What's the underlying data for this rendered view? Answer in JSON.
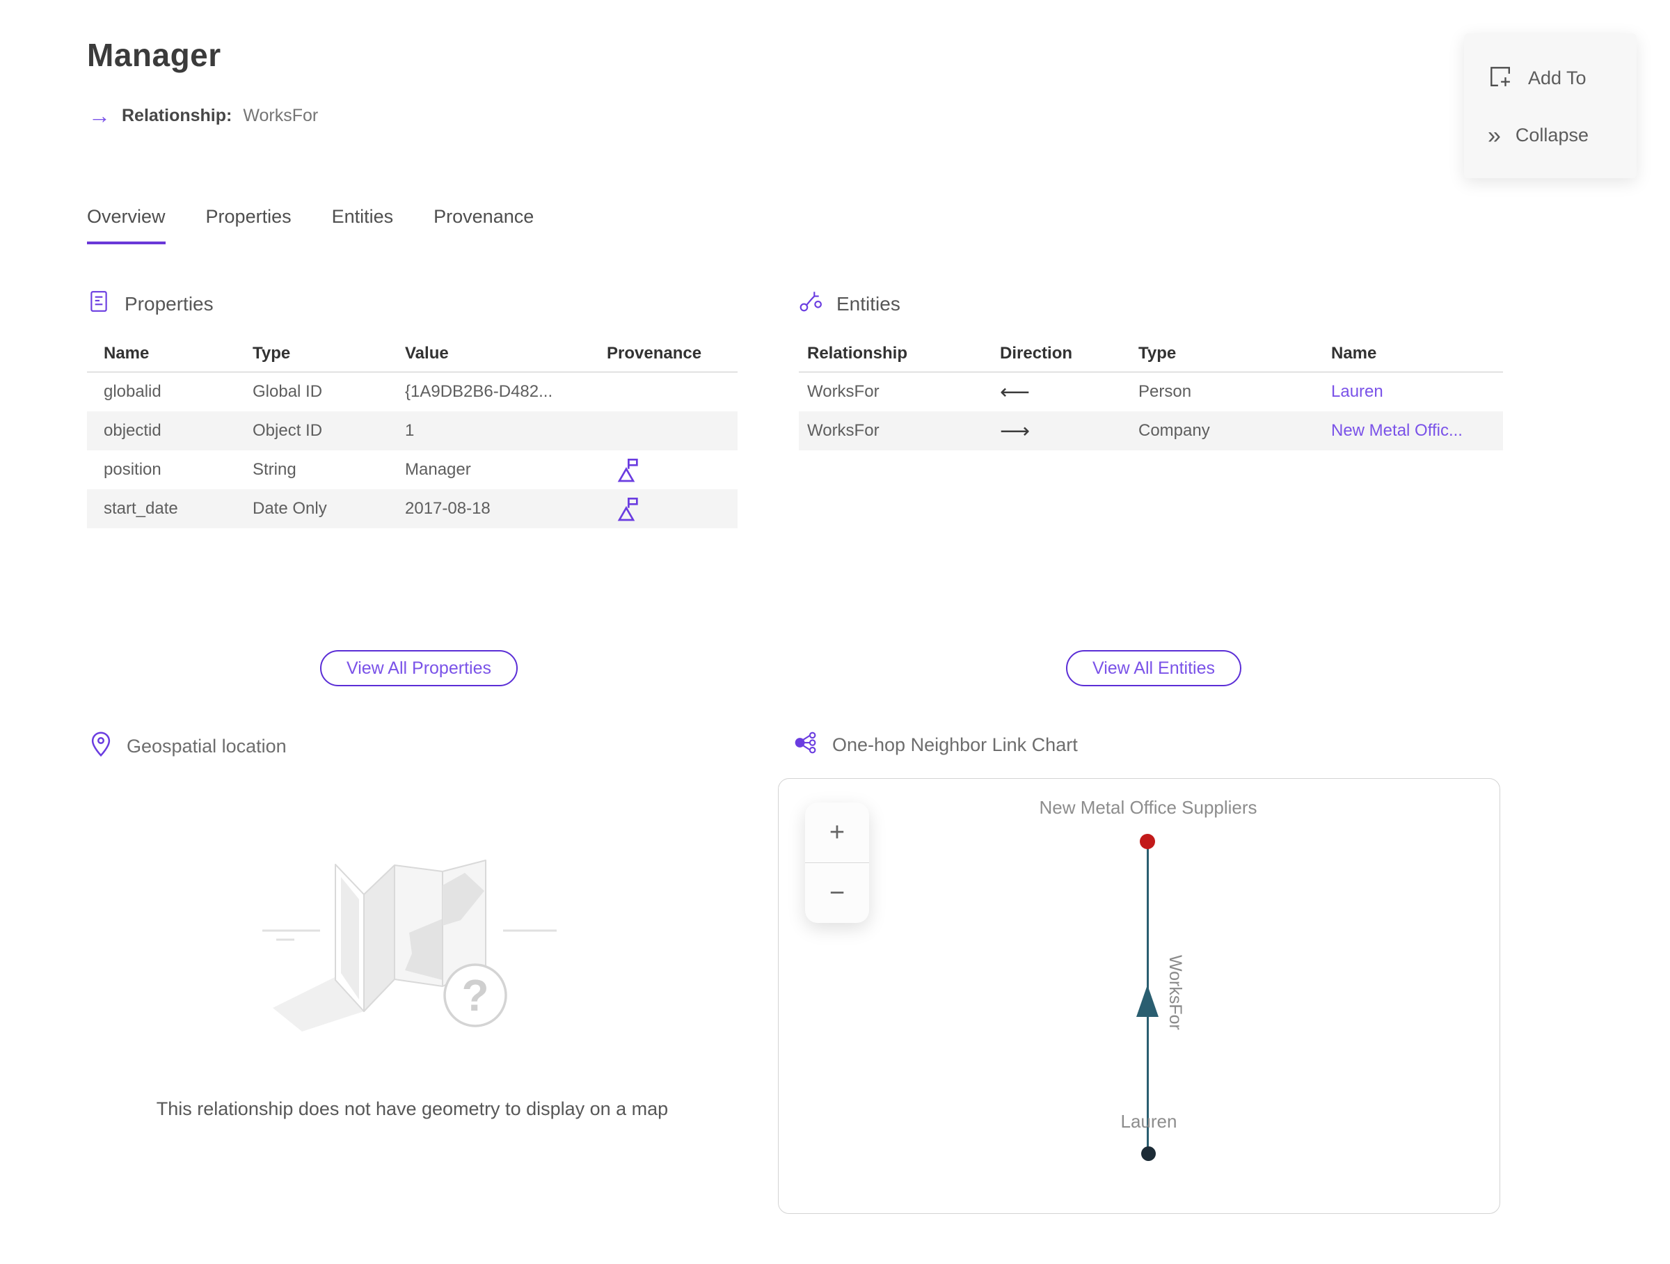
{
  "page": {
    "title": "Manager",
    "relationship_arrow": "→",
    "relationship_label": "Relationship:",
    "relationship_value": "WorksFor"
  },
  "actions": {
    "add_to": "Add To",
    "collapse": "Collapse",
    "collapse_icon": "»"
  },
  "tabs": [
    {
      "label": "Overview",
      "active": true
    },
    {
      "label": "Properties",
      "active": false
    },
    {
      "label": "Entities",
      "active": false
    },
    {
      "label": "Provenance",
      "active": false
    }
  ],
  "properties_section": {
    "title": "Properties",
    "columns": [
      "Name",
      "Type",
      "Value",
      "Provenance"
    ],
    "rows": [
      {
        "name": "globalid",
        "type": "Global ID",
        "value": "{1A9DB2B6-D482...",
        "has_provenance_flag": false
      },
      {
        "name": "objectid",
        "type": "Object ID",
        "value": "1",
        "has_provenance_flag": false
      },
      {
        "name": "position",
        "type": "String",
        "value": "Manager",
        "has_provenance_flag": true
      },
      {
        "name": "start_date",
        "type": "Date Only",
        "value": "2017-08-18",
        "has_provenance_flag": true
      }
    ],
    "view_all_label": "View All Properties"
  },
  "entities_section": {
    "title": "Entities",
    "columns": [
      "Relationship",
      "Direction",
      "Type",
      "Name"
    ],
    "rows": [
      {
        "relationship": "WorksFor",
        "direction": "⟵",
        "type": "Person",
        "name": "Lauren"
      },
      {
        "relationship": "WorksFor",
        "direction": "⟶",
        "type": "Company",
        "name": "New Metal Offic..."
      }
    ],
    "view_all_label": "View All Entities"
  },
  "geospatial_section": {
    "title": "Geospatial location",
    "map_question_mark": "?",
    "empty_message": "This relationship does not have geometry to display on a map"
  },
  "link_chart_section": {
    "title": "One-hop Neighbor Link Chart",
    "zoom_in_label": "+",
    "zoom_out_label": "−",
    "chart_data": {
      "type": "node-link",
      "nodes": [
        {
          "label": "New Metal Office Suppliers",
          "entity_type": "Company",
          "color": "#c21a1a",
          "position": "top"
        },
        {
          "label": "Lauren",
          "entity_type": "Person",
          "color": "#1c2b36",
          "position": "bottom"
        }
      ],
      "edges": [
        {
          "label": "WorksFor",
          "from": "Lauren",
          "to": "New Metal Office Suppliers",
          "direction": "up",
          "color": "#2a5e70"
        }
      ]
    }
  },
  "colors": {
    "accent_purple": "#6a3ce0",
    "link_purple": "#7a52e8",
    "active_tab_underline": "#6a38d8",
    "edge_teal": "#2a5e70",
    "node_red": "#c21a1a",
    "node_dark": "#1c2b36",
    "row_alt_bg": "#f4f4f4"
  }
}
